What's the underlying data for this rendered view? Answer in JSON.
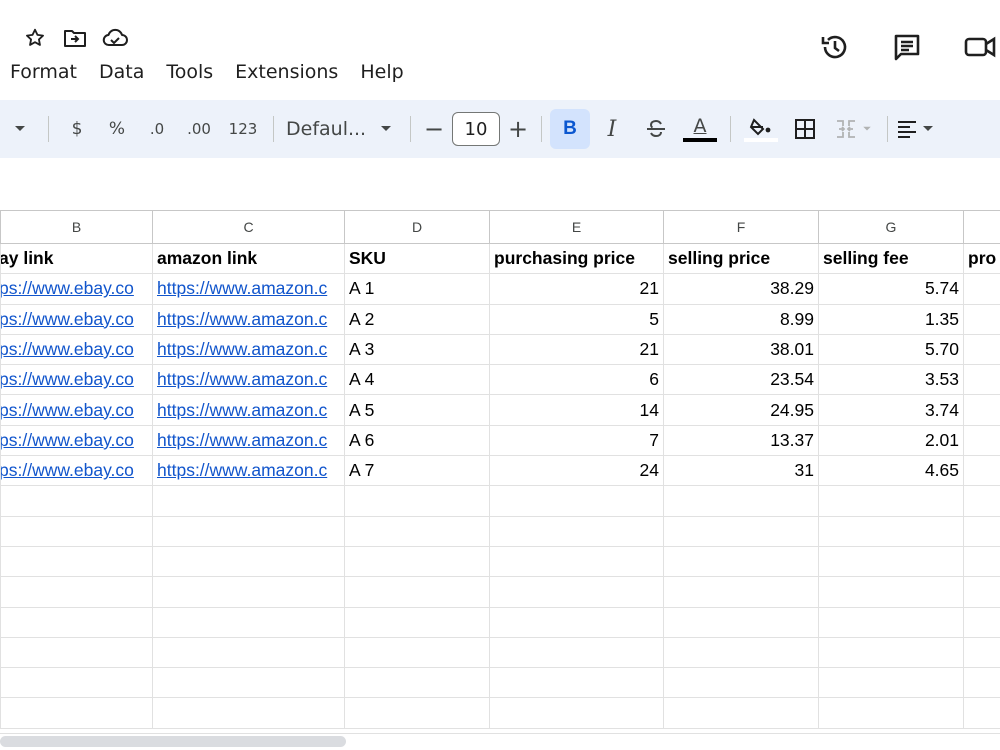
{
  "menu": [
    "Format",
    "Data",
    "Tools",
    "Extensions",
    "Help"
  ],
  "title_icons": [
    "star-icon",
    "move-to-folder-icon",
    "cloud-saved-icon"
  ],
  "right_icons": [
    "version-history-icon",
    "comments-icon",
    "meet-camera-icon"
  ],
  "toolbar": {
    "currency": "$",
    "percent": "%",
    "decrease_decimal": ".0",
    "increase_decimal": ".00",
    "number_format": "123",
    "font": "Defaul...",
    "minus": "−",
    "font_size": "10",
    "plus": "+",
    "bold": "B",
    "italic": "I",
    "text_color": "A"
  },
  "columns": [
    "B",
    "C",
    "D",
    "E",
    "F",
    "G",
    ""
  ],
  "header_row": [
    "ay link",
    "amazon link",
    "SKU",
    "purchasing price",
    "selling price",
    "selling fee",
    "pro"
  ],
  "rows": [
    [
      "ps://www.ebay.co",
      "https://www.amazon.c",
      "A 1",
      "21",
      "38.29",
      "5.74"
    ],
    [
      "ps://www.ebay.co",
      "https://www.amazon.c",
      "A 2",
      "5",
      "8.99",
      "1.35"
    ],
    [
      "ps://www.ebay.co",
      "https://www.amazon.c",
      "A 3",
      "21",
      "38.01",
      "5.70"
    ],
    [
      "ps://www.ebay.co",
      "https://www.amazon.c",
      "A 4",
      "6",
      "23.54",
      "3.53"
    ],
    [
      "ps://www.ebay.co",
      "https://www.amazon.c",
      "A 5",
      "14",
      "24.95",
      "3.74"
    ],
    [
      "ps://www.ebay.co",
      "https://www.amazon.c",
      "A 6",
      "7",
      "13.37",
      "2.01"
    ],
    [
      "ps://www.ebay.co",
      "https://www.amazon.c",
      "A 7",
      "24",
      "31",
      "4.65"
    ]
  ],
  "empty_rows": 8
}
